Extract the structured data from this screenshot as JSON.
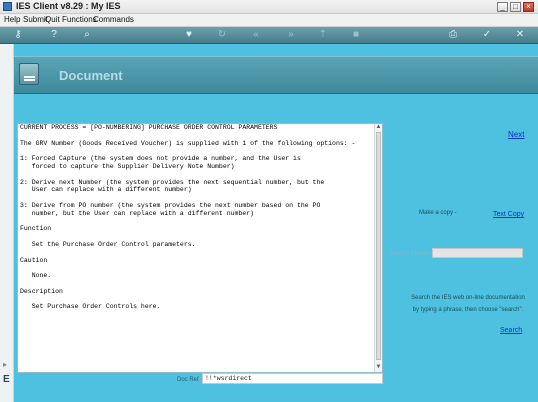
{
  "window": {
    "title": "IES Client v8.29 : My IES",
    "buttons": [
      "_",
      "□",
      "×"
    ]
  },
  "menu": [
    "Help",
    "Submit",
    "Quit",
    "Functions",
    "Commands"
  ],
  "toolbar": {
    "icons": [
      "key-icon",
      "help-icon",
      "search-icon",
      "heart-icon",
      "refresh-icon",
      "rewind-icon",
      "forward-icon",
      "up-icon",
      "stop-icon",
      "print-icon",
      "check-icon",
      "close-icon"
    ],
    "glyphs": [
      "⚷",
      "?",
      "⌕",
      "♥",
      "↻",
      "«",
      "»",
      "⇡",
      "■",
      "⎙",
      "✓",
      "✕"
    ]
  },
  "page": {
    "header_title": "Document",
    "next_label": "Next",
    "document_lines": [
      "CURRENT PROCESS = [PO-NUMBERING] PURCHASE ORDER CONTROL PARAMETERS",
      "",
      "The GRV Number (Goods Received Voucher) is supplied with 1 of the following options: -",
      "",
      "1: Forced Capture (the system does not provide a number, and the User is",
      "   forced to capture the Supplier Delivery Note Number)",
      "",
      "2: Derive next Number (the system provides the next sequential number, but the",
      "   User can replace with a different number)",
      "",
      "3: Derive from PO number (the system provides the next number based on the PO",
      "   number, but the User can replace with a different number)",
      "",
      "Function",
      "",
      "   Set the Purchase Order Control parameters.",
      "",
      "Caution",
      "",
      "   None.",
      "",
      "Description",
      "",
      "   Set Purchase Order Controls here."
    ],
    "make_copy_label": "Make a copy -",
    "text_copy_label": "Text Copy",
    "search_phrase_label": "Search Phrase",
    "search_phrase_value": "",
    "help_text": "Search the IES web on-line documentation by typing a phrase, then choose \"search\".",
    "search_label": "Search"
  },
  "status": {
    "label": "Doc Ref",
    "value": "!!*wsrdirect"
  },
  "colors": {
    "main_bg": "#4ec0e0",
    "header_band": "#3d8a9c",
    "link": "#0a39c4"
  }
}
